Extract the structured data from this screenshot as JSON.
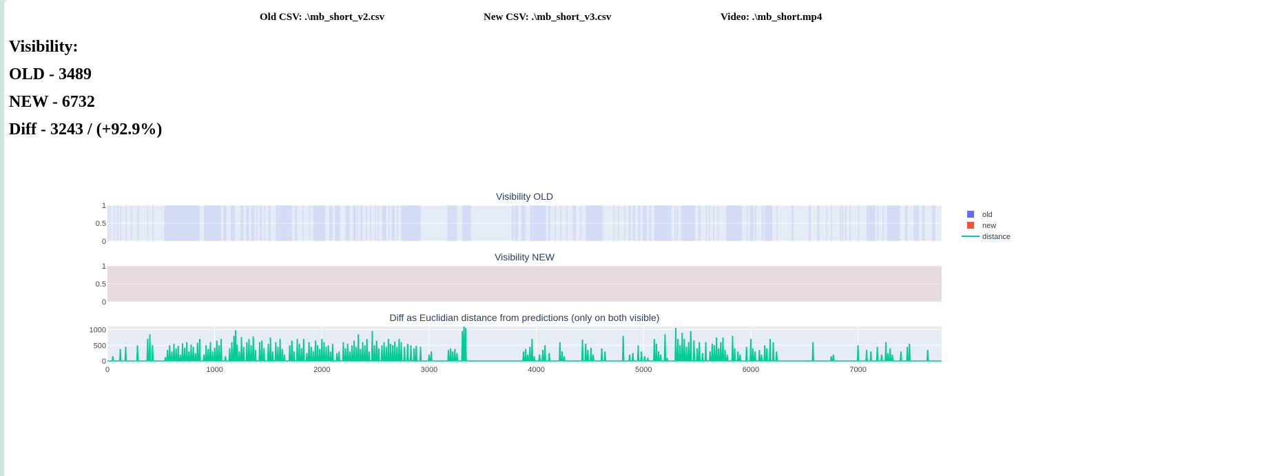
{
  "files": {
    "old_csv": "Old CSV: .\\mb_short_v2.csv",
    "new_csv": "New CSV: .\\mb_short_v3.csv",
    "video": "Video: .\\mb_short.mp4"
  },
  "visibility": {
    "heading": "Visibility:",
    "old": "OLD - 3489",
    "new": "NEW - 6732",
    "diff": "Diff - 3243 / (+92.9%)"
  },
  "colors": {
    "old": "#636efa",
    "new": "#ef553b",
    "distance": "#00cc96",
    "plot_bg": "#e5ecf6",
    "grid": "#ffffff",
    "text": "#2a3f5f",
    "tick_text": "#444444"
  },
  "chart_data": [
    {
      "type": "bar",
      "title": "Visibility OLD",
      "series_name": "old",
      "y_ticks": [
        "0",
        "0.5",
        "1"
      ],
      "ylim": [
        0,
        1
      ],
      "xlim": [
        0,
        7780
      ],
      "visible_ranges": [
        [
          0,
          10
        ],
        [
          20,
          30
        ],
        [
          60,
          70
        ],
        [
          90,
          100
        ],
        [
          120,
          130
        ],
        [
          170,
          180
        ],
        [
          220,
          230
        ],
        [
          280,
          295
        ],
        [
          370,
          380
        ],
        [
          420,
          430
        ],
        [
          530,
          860
        ],
        [
          900,
          1060
        ],
        [
          1080,
          1110
        ],
        [
          1150,
          1190
        ],
        [
          1240,
          1270
        ],
        [
          1290,
          1320
        ],
        [
          1340,
          1370
        ],
        [
          1390,
          1400
        ],
        [
          1420,
          1440
        ],
        [
          1460,
          1470
        ],
        [
          1500,
          1520
        ],
        [
          1570,
          1720
        ],
        [
          1750,
          1770
        ],
        [
          1820,
          1830
        ],
        [
          1880,
          1890
        ],
        [
          1920,
          2030
        ],
        [
          2070,
          2100
        ],
        [
          2120,
          2170
        ],
        [
          2220,
          2260
        ],
        [
          2290,
          2320
        ],
        [
          2330,
          2340
        ],
        [
          2360,
          2380
        ],
        [
          2410,
          2420
        ],
        [
          2450,
          2460
        ],
        [
          2490,
          2500
        ],
        [
          2520,
          2530
        ],
        [
          2560,
          2600
        ],
        [
          2620,
          2630
        ],
        [
          2650,
          2680
        ],
        [
          2700,
          2710
        ],
        [
          2740,
          2920
        ],
        [
          3170,
          3260
        ],
        [
          3310,
          3390
        ],
        [
          3770,
          3790
        ],
        [
          3800,
          3830
        ],
        [
          3860,
          3900
        ],
        [
          3940,
          4090
        ],
        [
          4110,
          4130
        ],
        [
          4170,
          4180
        ],
        [
          4220,
          4230
        ],
        [
          4280,
          4290
        ],
        [
          4340,
          4370
        ],
        [
          4410,
          4420
        ],
        [
          4460,
          4620
        ],
        [
          4720,
          4730
        ],
        [
          4760,
          4770
        ],
        [
          4820,
          4830
        ],
        [
          4860,
          4880
        ],
        [
          4900,
          4920
        ],
        [
          4950,
          4970
        ],
        [
          4990,
          5030
        ],
        [
          5050,
          5070
        ],
        [
          5100,
          5260
        ],
        [
          5290,
          5300
        ],
        [
          5310,
          5320
        ],
        [
          5350,
          5480
        ],
        [
          5510,
          5530
        ],
        [
          5580,
          5590
        ],
        [
          5610,
          5620
        ],
        [
          5650,
          5660
        ],
        [
          5690,
          5700
        ],
        [
          5770,
          5920
        ],
        [
          5960,
          5970
        ],
        [
          5990,
          6030
        ],
        [
          6040,
          6050
        ],
        [
          6100,
          6120
        ],
        [
          6130,
          6200
        ],
        [
          6240,
          6250
        ],
        [
          6380,
          6400
        ],
        [
          6540,
          6560
        ],
        [
          6620,
          6640
        ],
        [
          6700,
          6710
        ],
        [
          6750,
          6760
        ],
        [
          6830,
          6840
        ],
        [
          6850,
          6860
        ],
        [
          6880,
          6890
        ],
        [
          6920,
          6930
        ],
        [
          7000,
          7010
        ],
        [
          7080,
          7160
        ],
        [
          7180,
          7190
        ],
        [
          7230,
          7240
        ],
        [
          7270,
          7390
        ],
        [
          7440,
          7460
        ],
        [
          7520,
          7570
        ],
        [
          7600,
          7620
        ],
        [
          7690,
          7720
        ]
      ]
    },
    {
      "type": "bar",
      "title": "Visibility NEW",
      "series_name": "new",
      "y_ticks": [
        "0",
        "0.5",
        "1"
      ],
      "ylim": [
        0,
        1
      ],
      "xlim": [
        0,
        7780
      ],
      "visible_ranges": [
        [
          0,
          7780
        ]
      ]
    },
    {
      "type": "line",
      "title": "Diff as Euclidian distance from predictions (only on both visible)",
      "series_name": "distance",
      "x_ticks": [
        "0",
        "1000",
        "2000",
        "3000",
        "4000",
        "5000",
        "6000",
        "7000"
      ],
      "y_ticks": [
        "0",
        "500",
        "1000"
      ],
      "xlim": [
        0,
        7780
      ],
      "ylim": [
        0,
        1100
      ],
      "spikes": [
        [
          50,
          150
        ],
        [
          120,
          380
        ],
        [
          170,
          450
        ],
        [
          280,
          500
        ],
        [
          375,
          700
        ],
        [
          395,
          850
        ],
        [
          420,
          500
        ],
        [
          540,
          120
        ],
        [
          560,
          350
        ],
        [
          580,
          500
        ],
        [
          600,
          300
        ],
        [
          620,
          550
        ],
        [
          640,
          400
        ],
        [
          660,
          480
        ],
        [
          680,
          200
        ],
        [
          700,
          560
        ],
        [
          720,
          420
        ],
        [
          740,
          600
        ],
        [
          760,
          300
        ],
        [
          780,
          520
        ],
        [
          800,
          450
        ],
        [
          820,
          250
        ],
        [
          840,
          580
        ],
        [
          860,
          700
        ],
        [
          900,
          200
        ],
        [
          920,
          500
        ],
        [
          940,
          380
        ],
        [
          960,
          600
        ],
        [
          980,
          300
        ],
        [
          1000,
          420
        ],
        [
          1020,
          650
        ],
        [
          1040,
          500
        ],
        [
          1060,
          700
        ],
        [
          1100,
          150
        ],
        [
          1140,
          400
        ],
        [
          1160,
          600
        ],
        [
          1180,
          800
        ],
        [
          1195,
          980
        ],
        [
          1210,
          520
        ],
        [
          1230,
          300
        ],
        [
          1250,
          760
        ],
        [
          1270,
          450
        ],
        [
          1300,
          600
        ],
        [
          1320,
          700
        ],
        [
          1340,
          500
        ],
        [
          1360,
          780
        ],
        [
          1380,
          350
        ],
        [
          1420,
          600
        ],
        [
          1440,
          650
        ],
        [
          1460,
          400
        ],
        [
          1500,
          550
        ],
        [
          1520,
          750
        ],
        [
          1540,
          300
        ],
        [
          1570,
          600
        ],
        [
          1590,
          450
        ],
        [
          1610,
          700
        ],
        [
          1630,
          380
        ],
        [
          1650,
          200
        ],
        [
          1700,
          500
        ],
        [
          1720,
          650
        ],
        [
          1740,
          300
        ],
        [
          1770,
          700
        ],
        [
          1790,
          550
        ],
        [
          1810,
          400
        ],
        [
          1830,
          700
        ],
        [
          1860,
          250
        ],
        [
          1880,
          600
        ],
        [
          1900,
          450
        ],
        [
          1920,
          300
        ],
        [
          1940,
          650
        ],
        [
          1960,
          500
        ],
        [
          1980,
          380
        ],
        [
          2000,
          700
        ],
        [
          2020,
          600
        ],
        [
          2040,
          450
        ],
        [
          2060,
          500
        ],
        [
          2080,
          300
        ],
        [
          2100,
          550
        ],
        [
          2140,
          250
        ],
        [
          2160,
          300
        ],
        [
          2200,
          600
        ],
        [
          2220,
          400
        ],
        [
          2240,
          550
        ],
        [
          2260,
          300
        ],
        [
          2280,
          500
        ],
        [
          2300,
          650
        ],
        [
          2320,
          450
        ],
        [
          2340,
          850
        ],
        [
          2360,
          380
        ],
        [
          2380,
          600
        ],
        [
          2400,
          500
        ],
        [
          2420,
          700
        ],
        [
          2440,
          300
        ],
        [
          2470,
          950
        ],
        [
          2490,
          500
        ],
        [
          2510,
          650
        ],
        [
          2530,
          400
        ],
        [
          2560,
          500
        ],
        [
          2580,
          600
        ],
        [
          2600,
          450
        ],
        [
          2620,
          700
        ],
        [
          2640,
          550
        ],
        [
          2660,
          500
        ],
        [
          2680,
          620
        ],
        [
          2700,
          450
        ],
        [
          2720,
          700
        ],
        [
          2740,
          600
        ],
        [
          2770,
          450
        ],
        [
          2800,
          550
        ],
        [
          2830,
          500
        ],
        [
          2860,
          400
        ],
        [
          2880,
          480
        ],
        [
          2920,
          450
        ],
        [
          3000,
          200
        ],
        [
          3020,
          300
        ],
        [
          3180,
          350
        ],
        [
          3200,
          400
        ],
        [
          3220,
          300
        ],
        [
          3240,
          380
        ],
        [
          3260,
          250
        ],
        [
          3310,
          950
        ],
        [
          3325,
          1100
        ],
        [
          3340,
          1050
        ],
        [
          3880,
          300
        ],
        [
          3900,
          380
        ],
        [
          3920,
          200
        ],
        [
          3940,
          450
        ],
        [
          3960,
          700
        ],
        [
          3980,
          150
        ],
        [
          4030,
          200
        ],
        [
          4060,
          350
        ],
        [
          4080,
          500
        ],
        [
          4120,
          250
        ],
        [
          4220,
          600
        ],
        [
          4240,
          300
        ],
        [
          4260,
          150
        ],
        [
          4430,
          680
        ],
        [
          4460,
          550
        ],
        [
          4480,
          350
        ],
        [
          4510,
          420
        ],
        [
          4530,
          200
        ],
        [
          4610,
          400
        ],
        [
          4640,
          300
        ],
        [
          4810,
          800
        ],
        [
          4870,
          200
        ],
        [
          4900,
          250
        ],
        [
          4950,
          500
        ],
        [
          4980,
          300
        ],
        [
          5010,
          150
        ],
        [
          5040,
          100
        ],
        [
          5100,
          700
        ],
        [
          5120,
          550
        ],
        [
          5140,
          300
        ],
        [
          5160,
          200
        ],
        [
          5200,
          850
        ],
        [
          5220,
          100
        ],
        [
          5300,
          1050
        ],
        [
          5320,
          700
        ],
        [
          5340,
          500
        ],
        [
          5360,
          900
        ],
        [
          5380,
          700
        ],
        [
          5400,
          450
        ],
        [
          5420,
          600
        ],
        [
          5440,
          950
        ],
        [
          5470,
          650
        ],
        [
          5500,
          400
        ],
        [
          5520,
          600
        ],
        [
          5550,
          250
        ],
        [
          5580,
          600
        ],
        [
          5620,
          300
        ],
        [
          5640,
          550
        ],
        [
          5660,
          500
        ],
        [
          5680,
          750
        ],
        [
          5700,
          400
        ],
        [
          5720,
          600
        ],
        [
          5740,
          750
        ],
        [
          5760,
          350
        ],
        [
          5780,
          200
        ],
        [
          5830,
          800
        ],
        [
          5850,
          400
        ],
        [
          5880,
          300
        ],
        [
          5900,
          200
        ],
        [
          5960,
          450
        ],
        [
          6000,
          700
        ],
        [
          6020,
          400
        ],
        [
          6040,
          300
        ],
        [
          6080,
          350
        ],
        [
          6100,
          200
        ],
        [
          6130,
          500
        ],
        [
          6150,
          400
        ],
        [
          6180,
          700
        ],
        [
          6210,
          600
        ],
        [
          6240,
          300
        ],
        [
          6580,
          600
        ],
        [
          6750,
          150
        ],
        [
          6770,
          200
        ],
        [
          7000,
          500
        ],
        [
          7080,
          350
        ],
        [
          7120,
          300
        ],
        [
          7180,
          450
        ],
        [
          7220,
          200
        ],
        [
          7260,
          600
        ],
        [
          7280,
          250
        ],
        [
          7300,
          400
        ],
        [
          7320,
          200
        ],
        [
          7400,
          300
        ],
        [
          7460,
          450
        ],
        [
          7480,
          550
        ],
        [
          7650,
          350
        ]
      ]
    }
  ],
  "legend": {
    "items": [
      {
        "label": "old",
        "kind": "square",
        "color": "#636efa"
      },
      {
        "label": "new",
        "kind": "square",
        "color": "#ef553b"
      },
      {
        "label": "distance",
        "kind": "line",
        "color": "#00cc96"
      }
    ]
  }
}
